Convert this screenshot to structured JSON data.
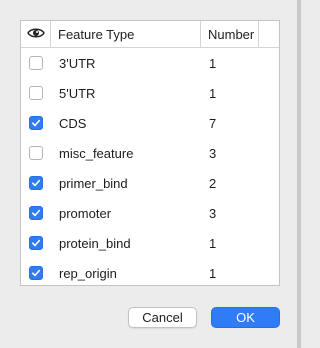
{
  "table": {
    "header": {
      "visibility_icon": "eye-icon",
      "feature_type_label": "Feature Type",
      "number_label": "Number"
    },
    "rows": [
      {
        "feature_type": "3'UTR",
        "number": "1",
        "checked": false
      },
      {
        "feature_type": "5'UTR",
        "number": "1",
        "checked": false
      },
      {
        "feature_type": "CDS",
        "number": "7",
        "checked": true
      },
      {
        "feature_type": "misc_feature",
        "number": "3",
        "checked": false
      },
      {
        "feature_type": "primer_bind",
        "number": "2",
        "checked": true
      },
      {
        "feature_type": "promoter",
        "number": "3",
        "checked": true
      },
      {
        "feature_type": "protein_bind",
        "number": "1",
        "checked": true
      },
      {
        "feature_type": "rep_origin",
        "number": "1",
        "checked": true
      }
    ]
  },
  "buttons": {
    "cancel_label": "Cancel",
    "ok_label": "OK"
  },
  "colors": {
    "accent": "#2f7cf6",
    "background": "#ececec"
  }
}
